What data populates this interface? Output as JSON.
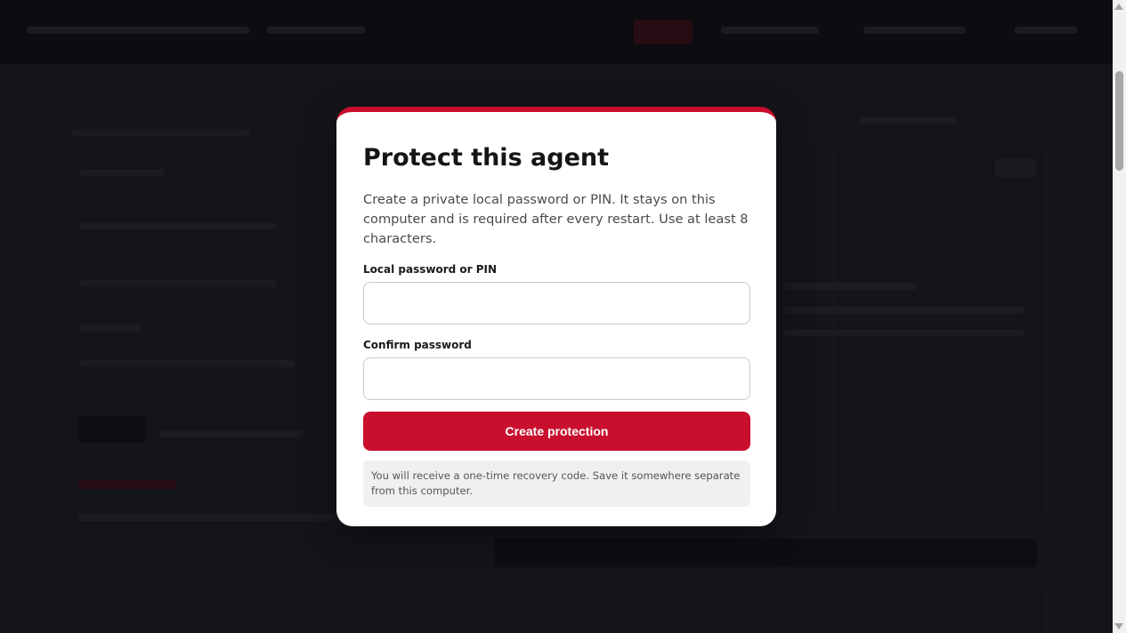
{
  "modal": {
    "title": "Protect this agent",
    "description": "Create a private local password or PIN. It stays on this computer and is required after every restart. Use at least 8 characters.",
    "password_label": "Local password or PIN",
    "password_value": "",
    "confirm_label": "Confirm password",
    "confirm_value": "",
    "submit_label": "Create protection",
    "note": "You will receive a one-time recovery code. Save it somewhere separate from this computer."
  },
  "colors": {
    "accent": "#c8102e",
    "backdrop": "#17181d",
    "modal_bg": "#ffffff"
  },
  "icons": {
    "scroll_up": "scroll-up-arrow-icon",
    "scroll_down": "scroll-down-arrow-icon"
  }
}
